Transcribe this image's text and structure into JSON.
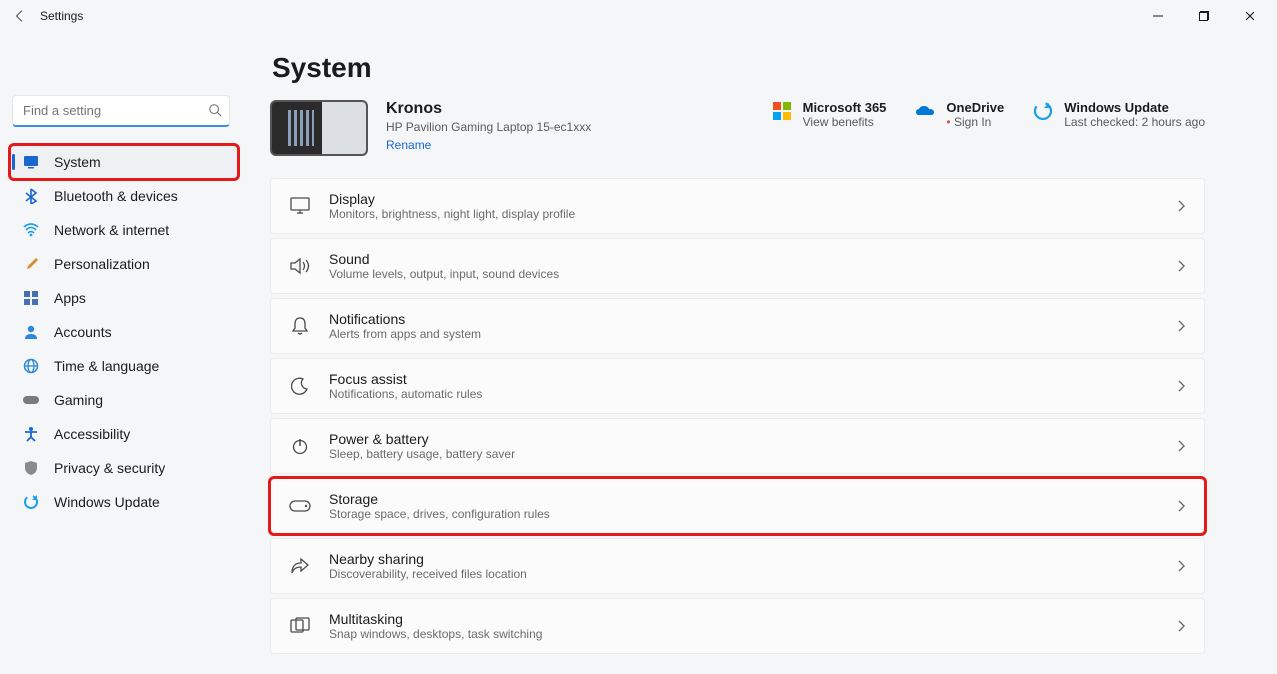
{
  "window": {
    "title": "Settings"
  },
  "search": {
    "placeholder": "Find a setting"
  },
  "nav": {
    "items": [
      {
        "label": "System",
        "icon": "system",
        "color": "#1a66d1"
      },
      {
        "label": "Bluetooth & devices",
        "icon": "bluetooth",
        "color": "#1a66d1"
      },
      {
        "label": "Network & internet",
        "icon": "wifi",
        "color": "#1aa0e6"
      },
      {
        "label": "Personalization",
        "icon": "brush",
        "color": "#d88b2a"
      },
      {
        "label": "Apps",
        "icon": "apps",
        "color": "#4a6fb0"
      },
      {
        "label": "Accounts",
        "icon": "person",
        "color": "#2a88d8"
      },
      {
        "label": "Time & language",
        "icon": "globe",
        "color": "#2a88d8"
      },
      {
        "label": "Gaming",
        "icon": "gamepad",
        "color": "#7a7a7a"
      },
      {
        "label": "Accessibility",
        "icon": "accessibility",
        "color": "#1a66d1"
      },
      {
        "label": "Privacy & security",
        "icon": "shield",
        "color": "#8a8a8a"
      },
      {
        "label": "Windows Update",
        "icon": "update",
        "color": "#1aa0e6"
      }
    ],
    "active_index": 0
  },
  "page": {
    "title": "System",
    "device": {
      "name": "Kronos",
      "model": "HP Pavilion Gaming Laptop 15-ec1xxx",
      "rename": "Rename"
    },
    "status": {
      "m365": {
        "title": "Microsoft 365",
        "sub": "View benefits"
      },
      "onedrive": {
        "title": "OneDrive",
        "sub": "Sign In"
      },
      "update": {
        "title": "Windows Update",
        "sub": "Last checked: 2 hours ago"
      }
    },
    "cards": [
      {
        "title": "Display",
        "sub": "Monitors, brightness, night light, display profile",
        "icon": "monitor"
      },
      {
        "title": "Sound",
        "sub": "Volume levels, output, input, sound devices",
        "icon": "sound"
      },
      {
        "title": "Notifications",
        "sub": "Alerts from apps and system",
        "icon": "bell"
      },
      {
        "title": "Focus assist",
        "sub": "Notifications, automatic rules",
        "icon": "moon"
      },
      {
        "title": "Power & battery",
        "sub": "Sleep, battery usage, battery saver",
        "icon": "power"
      },
      {
        "title": "Storage",
        "sub": "Storage space, drives, configuration rules",
        "icon": "drive"
      },
      {
        "title": "Nearby sharing",
        "sub": "Discoverability, received files location",
        "icon": "share"
      },
      {
        "title": "Multitasking",
        "sub": "Snap windows, desktops, task switching",
        "icon": "multitask"
      }
    ],
    "highlight_card_index": 5
  }
}
